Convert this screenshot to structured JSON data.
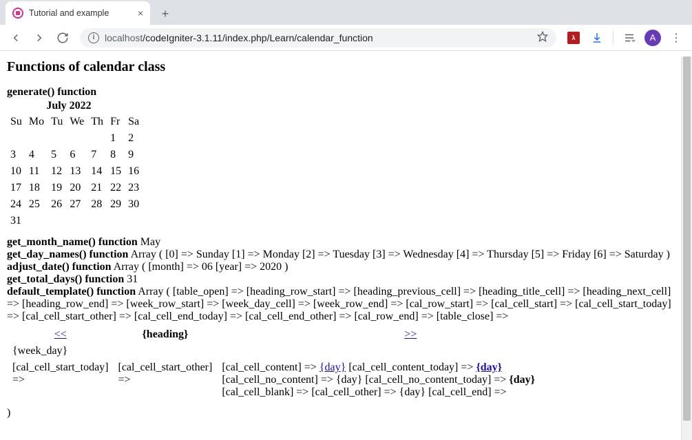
{
  "window": {
    "tab_title": "Tutorial and example",
    "url_host_prefix": "localhost",
    "url_path": "/codeIgniter-3.1.11/index.php/Learn/calendar_function",
    "avatar_letter": "A"
  },
  "page": {
    "h2": "Functions of calendar class",
    "generate_label": "generate() function",
    "month_heading": "July 2022",
    "day_headers": [
      "Su",
      "Mo",
      "Tu",
      "We",
      "Th",
      "Fr",
      "Sa"
    ],
    "weeks": [
      [
        "",
        "",
        "",
        "",
        "",
        "1",
        "2"
      ],
      [
        "3",
        "4",
        "5",
        "6",
        "7",
        "8",
        "9"
      ],
      [
        "10",
        "11",
        "12",
        "13",
        "14",
        "15",
        "16"
      ],
      [
        "17",
        "18",
        "19",
        "20",
        "21",
        "22",
        "23"
      ],
      [
        "24",
        "25",
        "26",
        "27",
        "28",
        "29",
        "30"
      ],
      [
        "31",
        "",
        "",
        "",
        "",
        "",
        ""
      ]
    ],
    "get_month_name_label": "get_month_name() function",
    "get_month_name_value": "May",
    "get_day_names_label": "get_day_names() function",
    "get_day_names_value": "Array ( [0] => Sunday [1] => Monday [2] => Tuesday [3] => Wednesday [4] => Thursday [5] => Friday [6] => Saturday )",
    "adjust_date_label": "adjust_date() function",
    "adjust_date_value": "Array ( [month] => 06 [year] => 2020 )",
    "get_total_days_label": "get_total_days() function",
    "get_total_days_value": "31",
    "default_template_label": "default_template() function",
    "default_template_value": "Array ( [table_open] => [heading_row_start] => [heading_previous_cell] => [heading_title_cell] => [heading_next_cell] => [heading_row_end] => [week_row_start] => [week_day_cell] => [week_row_end] => [cal_row_start] => [cal_cell_start] => [cal_cell_start_today] => [cal_cell_start_other] =>",
    "tmpl_prev": "<<",
    "tmpl_heading": "{heading}",
    "tmpl_next": ">>",
    "tmpl_weekday": "{week_day}",
    "tmpl_cell_start_today": "[cal_cell_start_today] =>",
    "tmpl_cell_start_other": "[cal_cell_start_other] =>",
    "tmpl_content_seg1": "[cal_cell_content] => ",
    "tmpl_link_day": "{day}",
    "tmpl_content_seg2": " [cal_cell_content_today] => ",
    "tmpl_link_day_bold": "{day}",
    "tmpl_content_seg3": " [cal_cell_no_content] => {day} [cal_cell_no_content_today] => ",
    "tmpl_bold_day": "{day}",
    "tmpl_content_seg4": " [cal_cell_blank] =>   [cal_cell_other] => {day} [cal_cell_end] =>",
    "tmpl_trailing": " [cal_cell_end_today] => [cal_cell_end_other] => [cal_row_end] => [table_close] =>",
    "closing_paren": ")"
  }
}
